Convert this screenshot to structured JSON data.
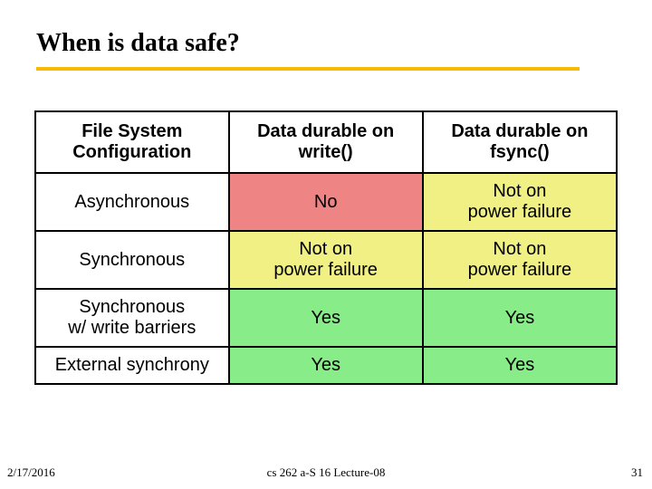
{
  "title": "When is data safe?",
  "table": {
    "headers": [
      "File System Configuration",
      "Data durable on write()",
      "Data durable on fsync()"
    ],
    "rows": [
      {
        "config": "Asynchronous",
        "write": "No",
        "fsync": "Not on\npower failure",
        "write_cls": "red",
        "fsync_cls": "yel"
      },
      {
        "config": "Synchronous",
        "write": "Not on\npower failure",
        "fsync": "Not on\npower failure",
        "write_cls": "yel",
        "fsync_cls": "yel"
      },
      {
        "config": "Synchronous\nw/ write barriers",
        "write": "Yes",
        "fsync": "Yes",
        "write_cls": "grn",
        "fsync_cls": "grn"
      },
      {
        "config": "External synchrony",
        "write": "Yes",
        "fsync": "Yes",
        "write_cls": "grn",
        "fsync_cls": "grn"
      }
    ]
  },
  "footer": {
    "date": "2/17/2016",
    "center": "cs 262 a-S 16 Lecture-08",
    "num": "31"
  },
  "chart_data": {
    "type": "table",
    "title": "When is data safe?",
    "columns": [
      "File System Configuration",
      "Data durable on write()",
      "Data durable on fsync()"
    ],
    "rows": [
      [
        "Asynchronous",
        "No",
        "Not on power failure"
      ],
      [
        "Synchronous",
        "Not on power failure",
        "Not on power failure"
      ],
      [
        "Synchronous w/ write barriers",
        "Yes",
        "Yes"
      ],
      [
        "External synchrony",
        "Yes",
        "Yes"
      ]
    ],
    "cell_colors": {
      "legend": {
        "red": "No",
        "yellow": "Not on power failure",
        "green": "Yes"
      },
      "write_column": [
        "red",
        "yellow",
        "green",
        "green"
      ],
      "fsync_column": [
        "yellow",
        "yellow",
        "green",
        "green"
      ]
    }
  }
}
